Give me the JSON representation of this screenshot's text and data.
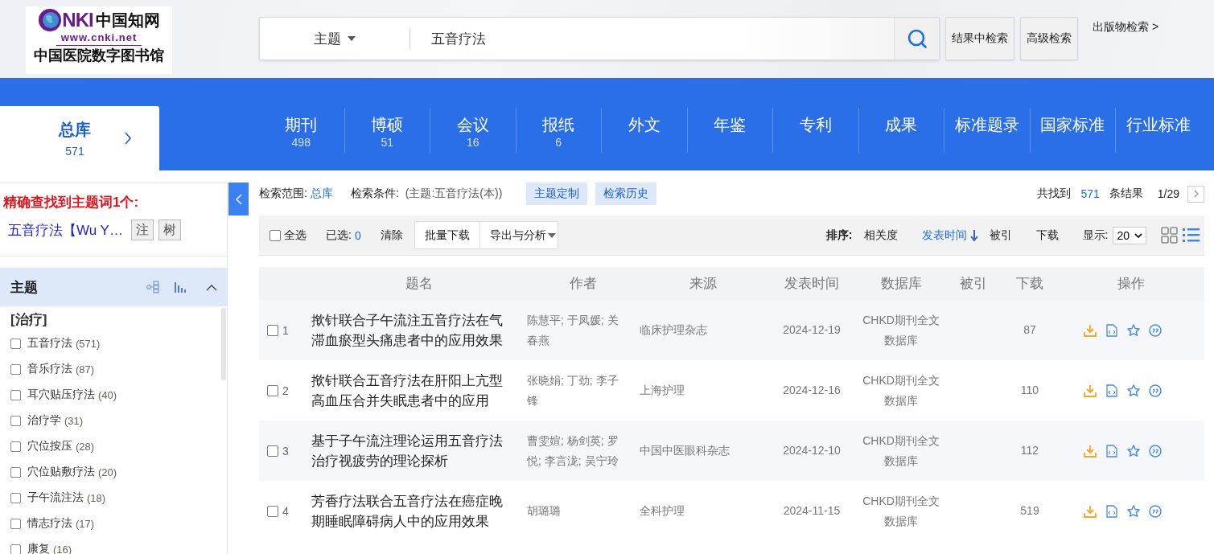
{
  "header": {
    "logo": {
      "brand": "NKI",
      "brand_cn": "中国知网",
      "url": "www.cnki.net",
      "library": "中国医院数字图书馆"
    },
    "search": {
      "field_type": "主题",
      "value": "五音疗法"
    },
    "buttons": [
      "结果中检索",
      "高级检索"
    ],
    "publication_link": "出版物检索 >"
  },
  "nav": {
    "total": {
      "label": "总库",
      "count": "571",
      "selected": true
    },
    "tabs": [
      {
        "label": "期刊",
        "count": "498",
        "selected": false
      },
      {
        "label": "博硕",
        "count": "51",
        "selected": false
      },
      {
        "label": "会议",
        "count": "16",
        "selected": false
      },
      {
        "label": "报纸",
        "count": "6",
        "selected": false
      },
      {
        "label": "外文",
        "selected": false
      },
      {
        "label": "年鉴",
        "selected": false
      },
      {
        "label": "专利",
        "selected": false
      },
      {
        "label": "成果",
        "selected": false
      },
      {
        "label": "标准题录",
        "selected": false
      },
      {
        "label": "国家标准",
        "selected": false
      },
      {
        "label": "行业标准",
        "selected": false
      }
    ]
  },
  "sidebar": {
    "subject_match": {
      "title": "精确查找到主题词1个:",
      "term": "五音疗法【Wu Y…",
      "buttons": [
        "注",
        "树"
      ]
    },
    "facet": {
      "title": "主题",
      "expanded": true,
      "group": "[治疗]",
      "items": [
        {
          "label": "五音疗法",
          "count": "(571)",
          "checked": false
        },
        {
          "label": "音乐疗法",
          "count": "(87)",
          "checked": false
        },
        {
          "label": "耳穴贴压疗法",
          "count": "(40)",
          "checked": false
        },
        {
          "label": "治疗学",
          "count": "(31)",
          "checked": false
        },
        {
          "label": "穴位按压",
          "count": "(28)",
          "checked": false
        },
        {
          "label": "穴位贴敷疗法",
          "count": "(20)",
          "checked": false
        },
        {
          "label": "子午流注法",
          "count": "(18)",
          "checked": false
        },
        {
          "label": "情志疗法",
          "count": "(17)",
          "checked": false
        },
        {
          "label": "康复",
          "count": "(16)",
          "checked": false
        }
      ]
    }
  },
  "results": {
    "scope_label": "检索范围:",
    "scope": "总库",
    "condition_label": "检索条件:",
    "condition": "(主题:五音疗法(本))",
    "tags": [
      "主题定制",
      "检索历史"
    ],
    "found_label": "共找到",
    "found": "571",
    "found_suffix": "条结果",
    "page": "1/29",
    "toolbar": {
      "select_all": {
        "label": "全选",
        "checked": false
      },
      "selected_label": "已选:",
      "selected_count": "0",
      "clear": "清除",
      "batch_download": "批量下载",
      "export": "导出与分析"
    },
    "sort": {
      "label": "排序:",
      "options": [
        {
          "label": "相关度",
          "selected": false
        },
        {
          "label": "发表时间",
          "selected": true
        },
        {
          "label": "被引",
          "selected": false
        },
        {
          "label": "下载",
          "selected": false
        }
      ]
    },
    "display": {
      "label": "显示:",
      "value": "20"
    },
    "view_modes": [
      {
        "kind": "grid",
        "selected": false
      },
      {
        "kind": "list",
        "selected": true
      }
    ],
    "table": {
      "columns": [
        "题名",
        "作者",
        "来源",
        "发表时间",
        "数据库",
        "被引",
        "下载",
        "操作"
      ],
      "rows": [
        {
          "checked": false,
          "index": "1",
          "title": "揿针联合子午流注五音疗法在气滞血瘀型头痛患者中的应用效果",
          "authors": "陈慧平; 于凤媛; 关春燕",
          "source": "临床护理杂志",
          "date": "2024-12-19",
          "database": "CHKD期刊全文数据库",
          "downloads": "87"
        },
        {
          "checked": false,
          "index": "2",
          "title": "揿针联合五音疗法在肝阳上亢型高血压合并失眠患者中的应用",
          "authors": "张晓娟; 丁劲; 李子锋",
          "source": "上海护理",
          "date": "2024-12-16",
          "database": "CHKD期刊全文数据库",
          "downloads": "110"
        },
        {
          "checked": false,
          "index": "3",
          "title": "基于子午流注理论运用五音疗法治疗视疲劳的理论探析",
          "authors": "曹雯媗; 杨剑英; 罗悦; 李言泷; 吴宁玲",
          "source": "中国中医眼科杂志",
          "date": "2024-12-10",
          "database": "CHKD期刊全文数据库",
          "downloads": "112"
        },
        {
          "checked": false,
          "index": "4",
          "title": "芳香疗法联合五音疗法在癌症晚期睡眠障碍病人中的应用效果",
          "authors": "胡璐璐",
          "source": "全科护理",
          "date": "2024-11-15",
          "database": "CHKD期刊全文数据库",
          "downloads": "519"
        }
      ]
    }
  }
}
